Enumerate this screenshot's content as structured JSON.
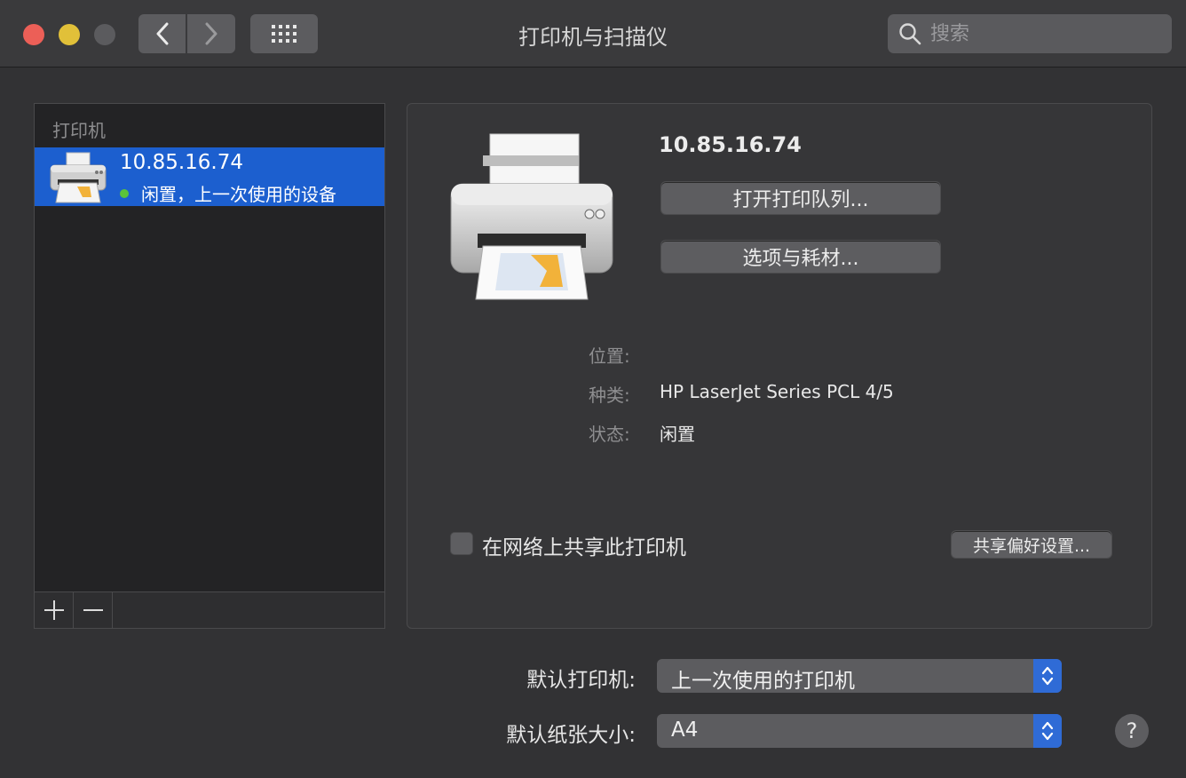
{
  "window": {
    "title": "打印机与扫描仪",
    "search_placeholder": "搜索"
  },
  "printer_list": {
    "header": "打印机",
    "items": [
      {
        "name": "10.85.16.74",
        "status": "闲置，上一次使用的设备",
        "status_color": "#5ac33a"
      }
    ],
    "add_label": "+",
    "remove_label": "—"
  },
  "detail": {
    "printer_name": "10.85.16.74",
    "open_queue_label": "打开打印队列...",
    "options_label": "选项与耗材...",
    "location_label": "位置:",
    "location_value": "",
    "kind_label": "种类:",
    "kind_value": "HP LaserJet Series PCL 4/5",
    "status_label": "状态:",
    "status_value": "闲置",
    "share_label": "在网络上共享此打印机",
    "share_checked": false,
    "share_prefs_label": "共享偏好设置..."
  },
  "defaults": {
    "default_printer_label": "默认打印机:",
    "default_printer_value": "上一次使用的打印机",
    "default_paper_label": "默认纸张大小:",
    "default_paper_value": "A4"
  },
  "help_label": "?",
  "colors": {
    "selection": "#1c5fcf",
    "accent": "#2f6bd6"
  }
}
